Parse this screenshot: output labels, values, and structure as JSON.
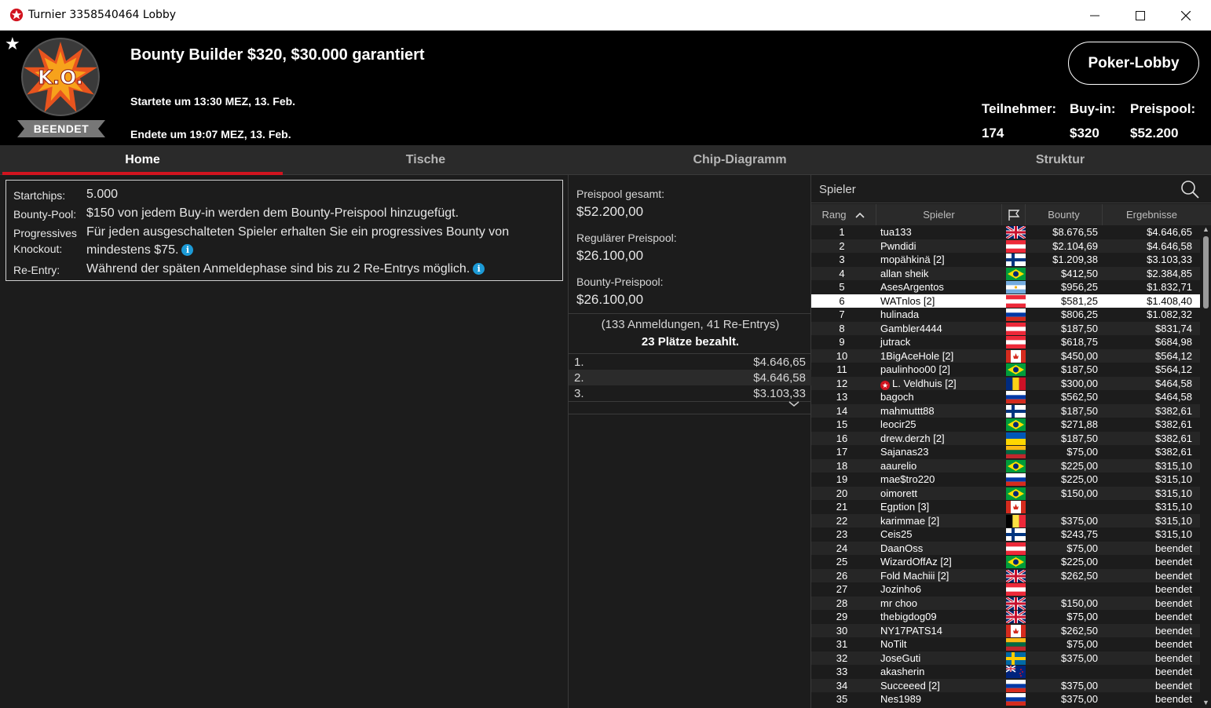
{
  "window": {
    "title": "Turnier 3358540464 Lobby"
  },
  "header": {
    "logo_text": "K.O.",
    "status": "BEENDET",
    "title": "Bounty Builder $320, $30.000 garantiert",
    "start": "Startete um 13:30 MEZ, 13. Feb.",
    "end": "Endete um 19:07 MEZ, 13. Feb.",
    "lobby_button": "Poker-Lobby",
    "stats": {
      "players_label": "Teilnehmer:",
      "players_value": "174",
      "buyin_label": "Buy-in:",
      "buyin_value": "$320",
      "pool_label": "Preispool:",
      "pool_value": "$52.200"
    }
  },
  "tabs": [
    "Home",
    "Tische",
    "Chip-Diagramm",
    "Struktur"
  ],
  "info": {
    "startchips_label": "Startchips:",
    "startchips_value": "5.000",
    "bountypool_label": "Bounty-Pool:",
    "bountypool_value": "$150 von jedem Buy-in werden dem Bounty-Preispool hinzugefügt.",
    "pko_label_1": "Progressives",
    "pko_label_2": "Knockout:",
    "pko_value_1": "Für jeden ausgeschalteten Spieler erhalten Sie ein progressives Bounty von",
    "pko_value_2": "mindestens $75.",
    "reentry_label": "Re-Entry:",
    "reentry_value": "Während der späten Anmeldephase sind bis zu 2 Re-Entrys möglich."
  },
  "prizepool": {
    "total_label": "Preispool gesamt:",
    "total_value": "$52.200,00",
    "regular_label": "Regulärer Preispool:",
    "regular_value": "$26.100,00",
    "bounty_label": "Bounty-Preispool:",
    "bounty_value": "$26.100,00",
    "registrations": "(133 Anmeldungen, 41 Re-Entrys)",
    "paid": "23 Plätze bezahlt.",
    "payouts": [
      {
        "pos": "1.",
        "amount": "$4.646,65"
      },
      {
        "pos": "2.",
        "amount": "$4.646,58"
      },
      {
        "pos": "3.",
        "amount": "$3.103,33"
      }
    ]
  },
  "players": {
    "search_placeholder": "Spieler",
    "columns": {
      "rank": "Rang",
      "player": "Spieler",
      "bounty": "Bounty",
      "result": "Ergebnisse"
    },
    "rows": [
      {
        "rank": "1",
        "name": "tua133",
        "flag": "gb",
        "bounty": "$8.676,55",
        "result": "$4.646,65"
      },
      {
        "rank": "2",
        "name": "Pwndidi",
        "flag": "at",
        "bounty": "$2.104,69",
        "result": "$4.646,58"
      },
      {
        "rank": "3",
        "name": "mopähkinä [2]",
        "flag": "fi",
        "bounty": "$1.209,38",
        "result": "$3.103,33"
      },
      {
        "rank": "4",
        "name": "allan sheik",
        "flag": "br",
        "bounty": "$412,50",
        "result": "$2.384,85"
      },
      {
        "rank": "5",
        "name": "AsesArgentos",
        "flag": "ar",
        "bounty": "$956,25",
        "result": "$1.832,71"
      },
      {
        "rank": "6",
        "name": "WATnlos [2]",
        "flag": "at",
        "bounty": "$581,25",
        "result": "$1.408,40"
      },
      {
        "rank": "7",
        "name": "hulinada",
        "flag": "ru",
        "bounty": "$806,25",
        "result": "$1.082,32"
      },
      {
        "rank": "8",
        "name": "Gambler4444",
        "flag": "at",
        "bounty": "$187,50",
        "result": "$831,74"
      },
      {
        "rank": "9",
        "name": "jutrack",
        "flag": "at",
        "bounty": "$618,75",
        "result": "$684,98"
      },
      {
        "rank": "10",
        "name": "1BigAceHole [2]",
        "flag": "ca",
        "bounty": "$450,00",
        "result": "$564,12"
      },
      {
        "rank": "11",
        "name": "paulinhoo00 [2]",
        "flag": "br",
        "bounty": "$187,50",
        "result": "$564,12"
      },
      {
        "rank": "12",
        "name": "L. Veldhuis [2]",
        "flag": "ro",
        "bounty": "$300,00",
        "result": "$464,58",
        "pro": true
      },
      {
        "rank": "13",
        "name": "bagoch",
        "flag": "ru",
        "bounty": "$562,50",
        "result": "$464,58"
      },
      {
        "rank": "14",
        "name": "mahmuttt88",
        "flag": "fi",
        "bounty": "$187,50",
        "result": "$382,61"
      },
      {
        "rank": "15",
        "name": "leocir25",
        "flag": "br",
        "bounty": "$271,88",
        "result": "$382,61"
      },
      {
        "rank": "16",
        "name": "drew.derzh [2]",
        "flag": "ua",
        "bounty": "$187,50",
        "result": "$382,61"
      },
      {
        "rank": "17",
        "name": "Sajanas23",
        "flag": "lt",
        "bounty": "$75,00",
        "result": "$382,61"
      },
      {
        "rank": "18",
        "name": "aaurelio",
        "flag": "br",
        "bounty": "$225,00",
        "result": "$315,10"
      },
      {
        "rank": "19",
        "name": "mae$tro220",
        "flag": "ru",
        "bounty": "$225,00",
        "result": "$315,10"
      },
      {
        "rank": "20",
        "name": "oimorett",
        "flag": "br",
        "bounty": "$150,00",
        "result": "$315,10"
      },
      {
        "rank": "21",
        "name": "Egption [3]",
        "flag": "ca",
        "bounty": "",
        "result": "$315,10"
      },
      {
        "rank": "22",
        "name": "karimmae [2]",
        "flag": "be",
        "bounty": "$375,00",
        "result": "$315,10"
      },
      {
        "rank": "23",
        "name": "Ceis25",
        "flag": "fi",
        "bounty": "$243,75",
        "result": "$315,10"
      },
      {
        "rank": "24",
        "name": "DaanOss",
        "flag": "at",
        "bounty": "$75,00",
        "result": "beendet"
      },
      {
        "rank": "25",
        "name": "WizardOffAz [2]",
        "flag": "br",
        "bounty": "$225,00",
        "result": "beendet"
      },
      {
        "rank": "26",
        "name": "Fold Machiii [2]",
        "flag": "gb",
        "bounty": "$262,50",
        "result": "beendet"
      },
      {
        "rank": "27",
        "name": "Jozinho6",
        "flag": "at",
        "bounty": "",
        "result": "beendet"
      },
      {
        "rank": "28",
        "name": "mr choo",
        "flag": "gb",
        "bounty": "$150,00",
        "result": "beendet"
      },
      {
        "rank": "29",
        "name": "thebigdog09",
        "flag": "gb",
        "bounty": "$75,00",
        "result": "beendet"
      },
      {
        "rank": "30",
        "name": "NY17PATS14",
        "flag": "ca",
        "bounty": "$262,50",
        "result": "beendet"
      },
      {
        "rank": "31",
        "name": "NoTilt",
        "flag": "lt",
        "bounty": "$75,00",
        "result": "beendet"
      },
      {
        "rank": "32",
        "name": "JoseGuti",
        "flag": "se",
        "bounty": "$375,00",
        "result": "beendet"
      },
      {
        "rank": "33",
        "name": "akasherin",
        "flag": "nz",
        "bounty": "",
        "result": "beendet"
      },
      {
        "rank": "34",
        "name": "Succeeed [2]",
        "flag": "ru",
        "bounty": "$375,00",
        "result": "beendet"
      },
      {
        "rank": "35",
        "name": "Nes1989",
        "flag": "ru",
        "bounty": "$375,00",
        "result": "beendet"
      }
    ],
    "selected_rank": "6"
  },
  "colors": {
    "accent": "#d2141f",
    "info_icon": "#1c9ad6",
    "background": "#1c1c1c",
    "header_bg": "#000000"
  }
}
